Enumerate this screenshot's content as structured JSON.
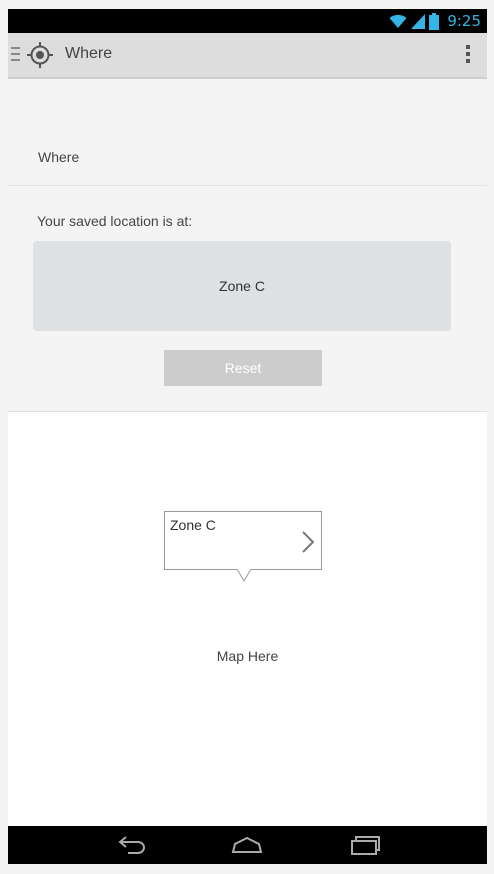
{
  "status_bar": {
    "time": "9:25",
    "icons": [
      "wifi-icon",
      "signal-icon",
      "battery-icon"
    ],
    "accent_color": "#33b5e5"
  },
  "action_bar": {
    "title": "Where",
    "app_icon": "location-target-icon",
    "overflow_icon": "overflow-menu-icon"
  },
  "top_panel": {
    "section_header": "Where",
    "saved_label": "Your saved location is at:",
    "saved_location": "Zone C",
    "reset_label": "Reset"
  },
  "map": {
    "callout_title": "Zone C",
    "callout_icon": "chevron-right-icon",
    "placeholder": "Map Here"
  },
  "nav_bar": {
    "icons": [
      "back-icon",
      "home-icon",
      "recent-apps-icon"
    ]
  }
}
